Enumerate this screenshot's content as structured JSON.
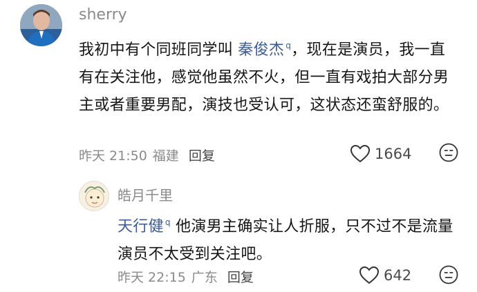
{
  "comments": [
    {
      "username": "sherry",
      "text_before": "我初中有个同班同学叫 ",
      "mention": "秦俊杰",
      "text_after": "，现在是演员，我一直有在关注他，感觉他虽然不火，但一直有戏拍大部分男主或者重要男配，演技也受认可，这状态还蛮舒服的。",
      "time": "昨天 21:50",
      "location": "福建",
      "reply_label": "回复",
      "likes": "1664"
    },
    {
      "username": "皓月千里",
      "mention": "天行健",
      "text_after": " 他演男主确实让人折服，只不过不是流量演员不太受到关注吧。",
      "time": "昨天 22:15",
      "location": "广东",
      "reply_label": "回复",
      "likes": "642"
    }
  ],
  "icons": {
    "search_mark": "magnifier-glyph",
    "like": "heart-outline-icon",
    "dislike": "dislike-face-icon"
  }
}
